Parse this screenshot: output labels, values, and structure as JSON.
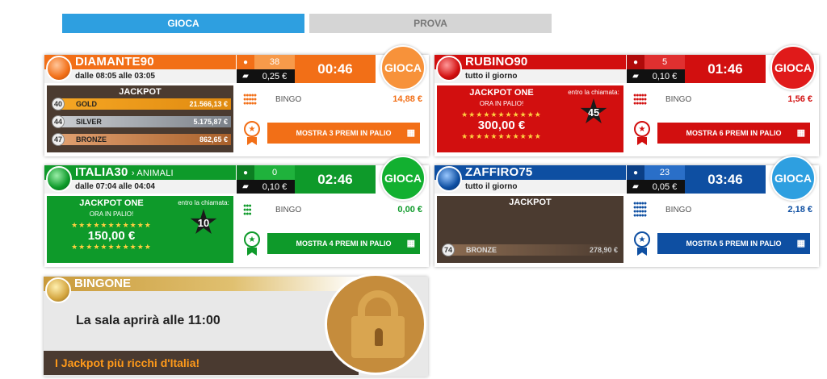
{
  "tabs": [
    {
      "label": "GIOCA"
    },
    {
      "label": "PROVA"
    }
  ],
  "rooms": [
    {
      "name": "DIAMANTE90",
      "subtitle": "",
      "hours": "dalle 08:05 alle 03:05",
      "players": "38",
      "card_price": "0,25 €",
      "timer": "00:46",
      "play_label": "GIOCA",
      "jackpot": {
        "title": "JACKPOT",
        "tiers": [
          {
            "badge": "40",
            "name": "GOLD",
            "amount": "21.566,13 €"
          },
          {
            "badge": "44",
            "name": "SILVER",
            "amount": "5.175,87 €"
          },
          {
            "badge": "47",
            "name": "BRONZE",
            "amount": "862,65 €"
          }
        ]
      },
      "bingo_label": "BINGO",
      "bingo_prize": "14,88 €",
      "prizes_button": "MOSTRA 3 PREMI IN PALIO",
      "color": "#f26f17"
    },
    {
      "name": "RUBINO90",
      "subtitle": "",
      "hours": "tutto il giorno",
      "players": "5",
      "card_price": "0,10 €",
      "timer": "01:46",
      "play_label": "GIOCA",
      "jackpot_one": {
        "title": "JACKPOT ONE",
        "sub": "ORA IN PALIO!",
        "amount": "300,00 €",
        "within": "entro la chiamata:",
        "call": "45"
      },
      "bingo_label": "BINGO",
      "bingo_prize": "1,56 €",
      "prizes_button": "MOSTRA 6 PREMI IN PALIO",
      "color": "#d20f0f"
    },
    {
      "name": "ITALIA30",
      "subtitle": "› ANIMALI",
      "hours": "dalle 07:04 alle 04:04",
      "players": "0",
      "card_price": "0,10 €",
      "timer": "02:46",
      "play_label": "GIOCA",
      "jackpot_one": {
        "title": "JACKPOT ONE",
        "sub": "ORA IN PALIO!",
        "amount": "150,00 €",
        "within": "entro la chiamata:",
        "call": "10"
      },
      "bingo_label": "BINGO",
      "bingo_prize": "0,00 €",
      "prizes_button": "MOSTRA 4 PREMI IN PALIO",
      "color": "#0e9a2a"
    },
    {
      "name": "ZAFFIRO75",
      "subtitle": "",
      "hours": "tutto il giorno",
      "players": "23",
      "card_price": "0,05 €",
      "timer": "03:46",
      "play_label": "GIOCA",
      "jackpot": {
        "title": "JACKPOT",
        "tiers": [
          {
            "badge": "74",
            "name": "BRONZE",
            "amount": "278,90 €"
          }
        ]
      },
      "bingo_label": "BINGO",
      "bingo_prize": "2,18 €",
      "prizes_button": "MOSTRA 5 PREMI IN PALIO",
      "color": "#0e4fa2"
    }
  ],
  "bingone": {
    "name": "BINGONE",
    "message": "La sala aprirà alle 11:00",
    "footer": "I Jackpot più ricchi d'Italia!"
  },
  "icons": {
    "players": "people-icon",
    "card": "card-icon",
    "grid": "grid-icon",
    "lock": "lock-icon"
  },
  "colors": {
    "tab_active": "#2e9fe0",
    "tab_inactive": "#d5d5d5",
    "jackpot_bg": "#4b3b30",
    "gold": "#f5a623",
    "silver": "#8a8f96",
    "bronze": "#b5713a"
  }
}
